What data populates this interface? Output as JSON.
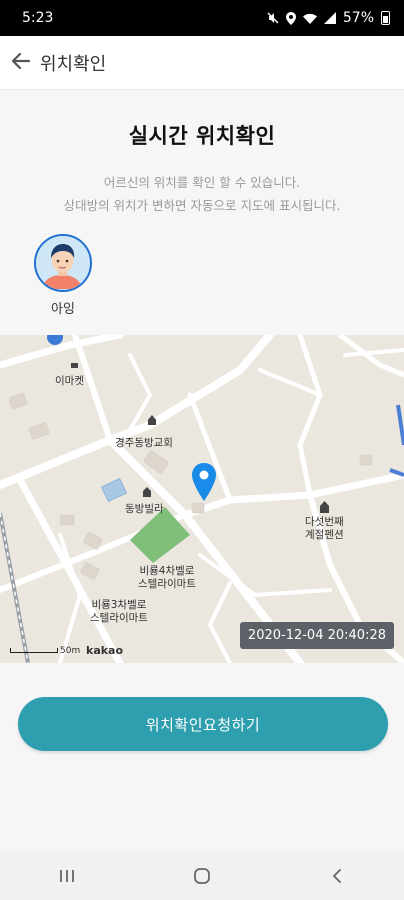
{
  "status_bar": {
    "time": "5:23",
    "battery": "57%",
    "icons": [
      "mute-icon",
      "location-icon",
      "wifi-icon",
      "signal-icon",
      "battery-icon"
    ]
  },
  "header": {
    "back_icon": "arrow-left-icon",
    "title": "위치확인"
  },
  "intro": {
    "title": "실시간 위치확인",
    "desc_line1": "어르신의 위치를 확인 할 수 있습니다.",
    "desc_line2": "상대방의 위치가 변하면 자동으로 지도에 표시됩니다."
  },
  "profile": {
    "name": "아잉"
  },
  "map": {
    "labels": {
      "emart": "이마켓",
      "church": "경주동방교회",
      "villa": "동방빌라",
      "pension": "다섯번째\n계절펜션",
      "mart1": "비룡4차벨로\n스텔라이마트",
      "mart2": "비룡3차벨로\n스텔라이마트"
    },
    "timestamp": "2020-12-04 20:40:28",
    "scale_label": "50m",
    "brand": "kakao",
    "marker_color": "#1a8be8"
  },
  "actions": {
    "request_label": "위치확인요청하기",
    "accent_color": "#2e9fae"
  },
  "nav": {
    "recent_icon": "recent-apps-icon",
    "home_icon": "home-icon",
    "back_icon": "back-icon"
  }
}
